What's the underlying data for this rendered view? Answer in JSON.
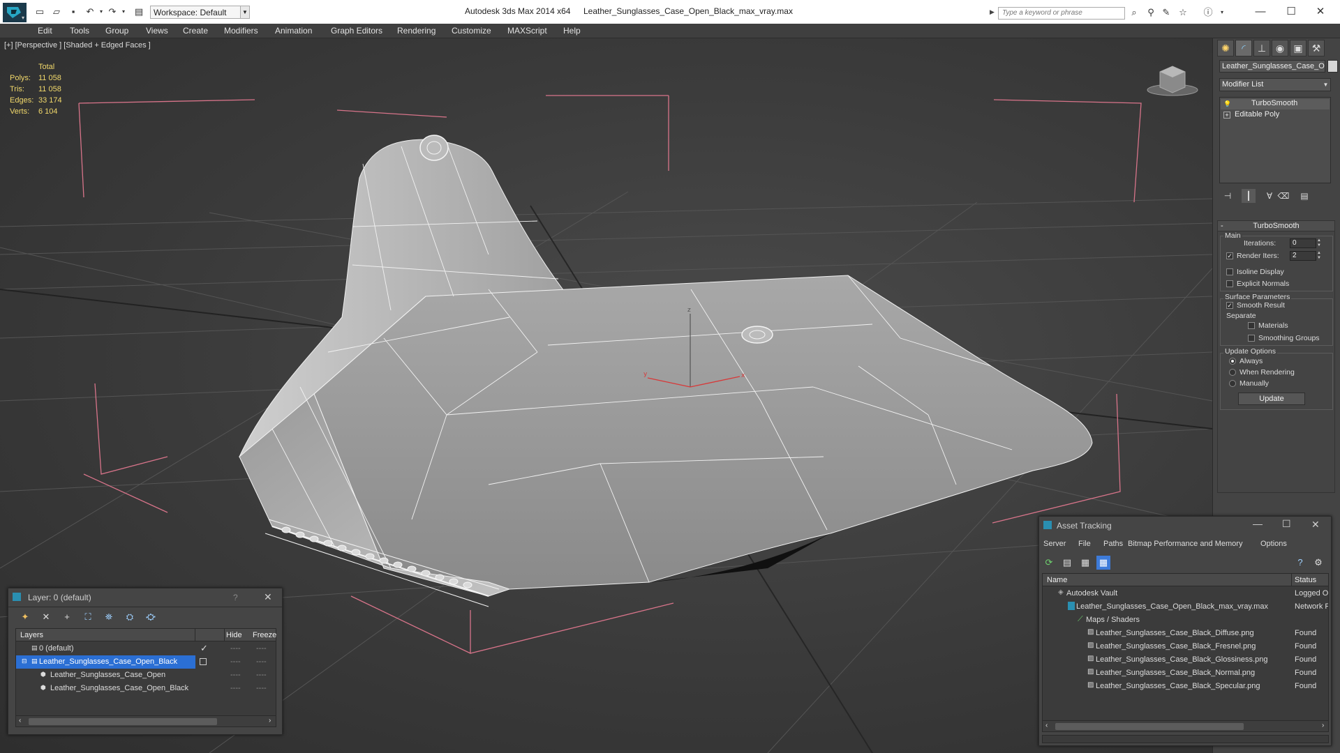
{
  "titlebar": {
    "workspace": "Workspace: Default",
    "app_title": "Autodesk 3ds Max  2014 x64",
    "file_title": "Leather_Sunglasses_Case_Open_Black_max_vray.max",
    "search_placeholder": "Type a keyword or phrase"
  },
  "menu": [
    "Edit",
    "Tools",
    "Group",
    "Views",
    "Create",
    "Modifiers",
    "Animation",
    "Graph Editors",
    "Rendering",
    "Customize",
    "MAXScript",
    "Help"
  ],
  "viewport": {
    "label": "[+] [Perspective ] [Shaded + Edged Faces ]",
    "stats": {
      "header": "Total",
      "rows": [
        {
          "label": "Polys:",
          "value": "11 058"
        },
        {
          "label": "Tris:",
          "value": "11 058"
        },
        {
          "label": "Edges:",
          "value": "33 174"
        },
        {
          "label": "Verts:",
          "value": "6 104"
        }
      ]
    },
    "axis": {
      "z": "z",
      "x": "x",
      "y": "y"
    }
  },
  "command_panel": {
    "object_name": "Leather_Sunglasses_Case_O",
    "modifier_list": "Modifier List",
    "stack": [
      "TurboSmooth",
      "Editable Poly"
    ],
    "rollout_title": "TurboSmooth",
    "main_group": "Main",
    "iterations_label": "Iterations:",
    "iterations_value": "0",
    "render_iters_label": "Render Iters:",
    "render_iters_value": "2",
    "render_iters_checked": true,
    "isoline_label": "Isoline Display",
    "explicit_normals_label": "Explicit Normals",
    "surface_group": "Surface Parameters",
    "smooth_result_label": "Smooth Result",
    "separate_label": "Separate",
    "materials_label": "Materials",
    "smoothing_groups_label": "Smoothing Groups",
    "update_group": "Update Options",
    "always_label": "Always",
    "when_rendering_label": "When Rendering",
    "manually_label": "Manually",
    "update_button": "Update"
  },
  "layer_window": {
    "title": "Layer: 0 (default)",
    "help": "?",
    "col_layers": "Layers",
    "col_hide": "Hide",
    "col_freeze": "Freeze",
    "rows": [
      {
        "name": "0 (default)",
        "level": 0,
        "selected": false
      },
      {
        "name": "Leather_Sunglasses_Case_Open_Black",
        "level": 0,
        "selected": true
      },
      {
        "name": "Leather_Sunglasses_Case_Open",
        "level": 1,
        "selected": false
      },
      {
        "name": "Leather_Sunglasses_Case_Open_Black",
        "level": 1,
        "selected": false
      }
    ]
  },
  "asset_window": {
    "title": "Asset Tracking",
    "menu": [
      "Server",
      "File",
      "Paths",
      "Bitmap Performance and Memory",
      "Options"
    ],
    "col_name": "Name",
    "col_status": "Status",
    "rows": [
      {
        "name": "Autodesk Vault",
        "status": "Logged O",
        "level": 1
      },
      {
        "name": "Leather_Sunglasses_Case_Open_Black_max_vray.max",
        "status": "Network F",
        "level": 2
      },
      {
        "name": "Maps / Shaders",
        "status": "",
        "level": 3
      },
      {
        "name": "Leather_Sunglasses_Case_Black_Diffuse.png",
        "status": "Found",
        "level": 4
      },
      {
        "name": "Leather_Sunglasses_Case_Black_Fresnel.png",
        "status": "Found",
        "level": 4
      },
      {
        "name": "Leather_Sunglasses_Case_Black_Glossiness.png",
        "status": "Found",
        "level": 4
      },
      {
        "name": "Leather_Sunglasses_Case_Black_Normal.png",
        "status": "Found",
        "level": 4
      },
      {
        "name": "Leather_Sunglasses_Case_Black_Specular.png",
        "status": "Found",
        "level": 4
      }
    ]
  }
}
